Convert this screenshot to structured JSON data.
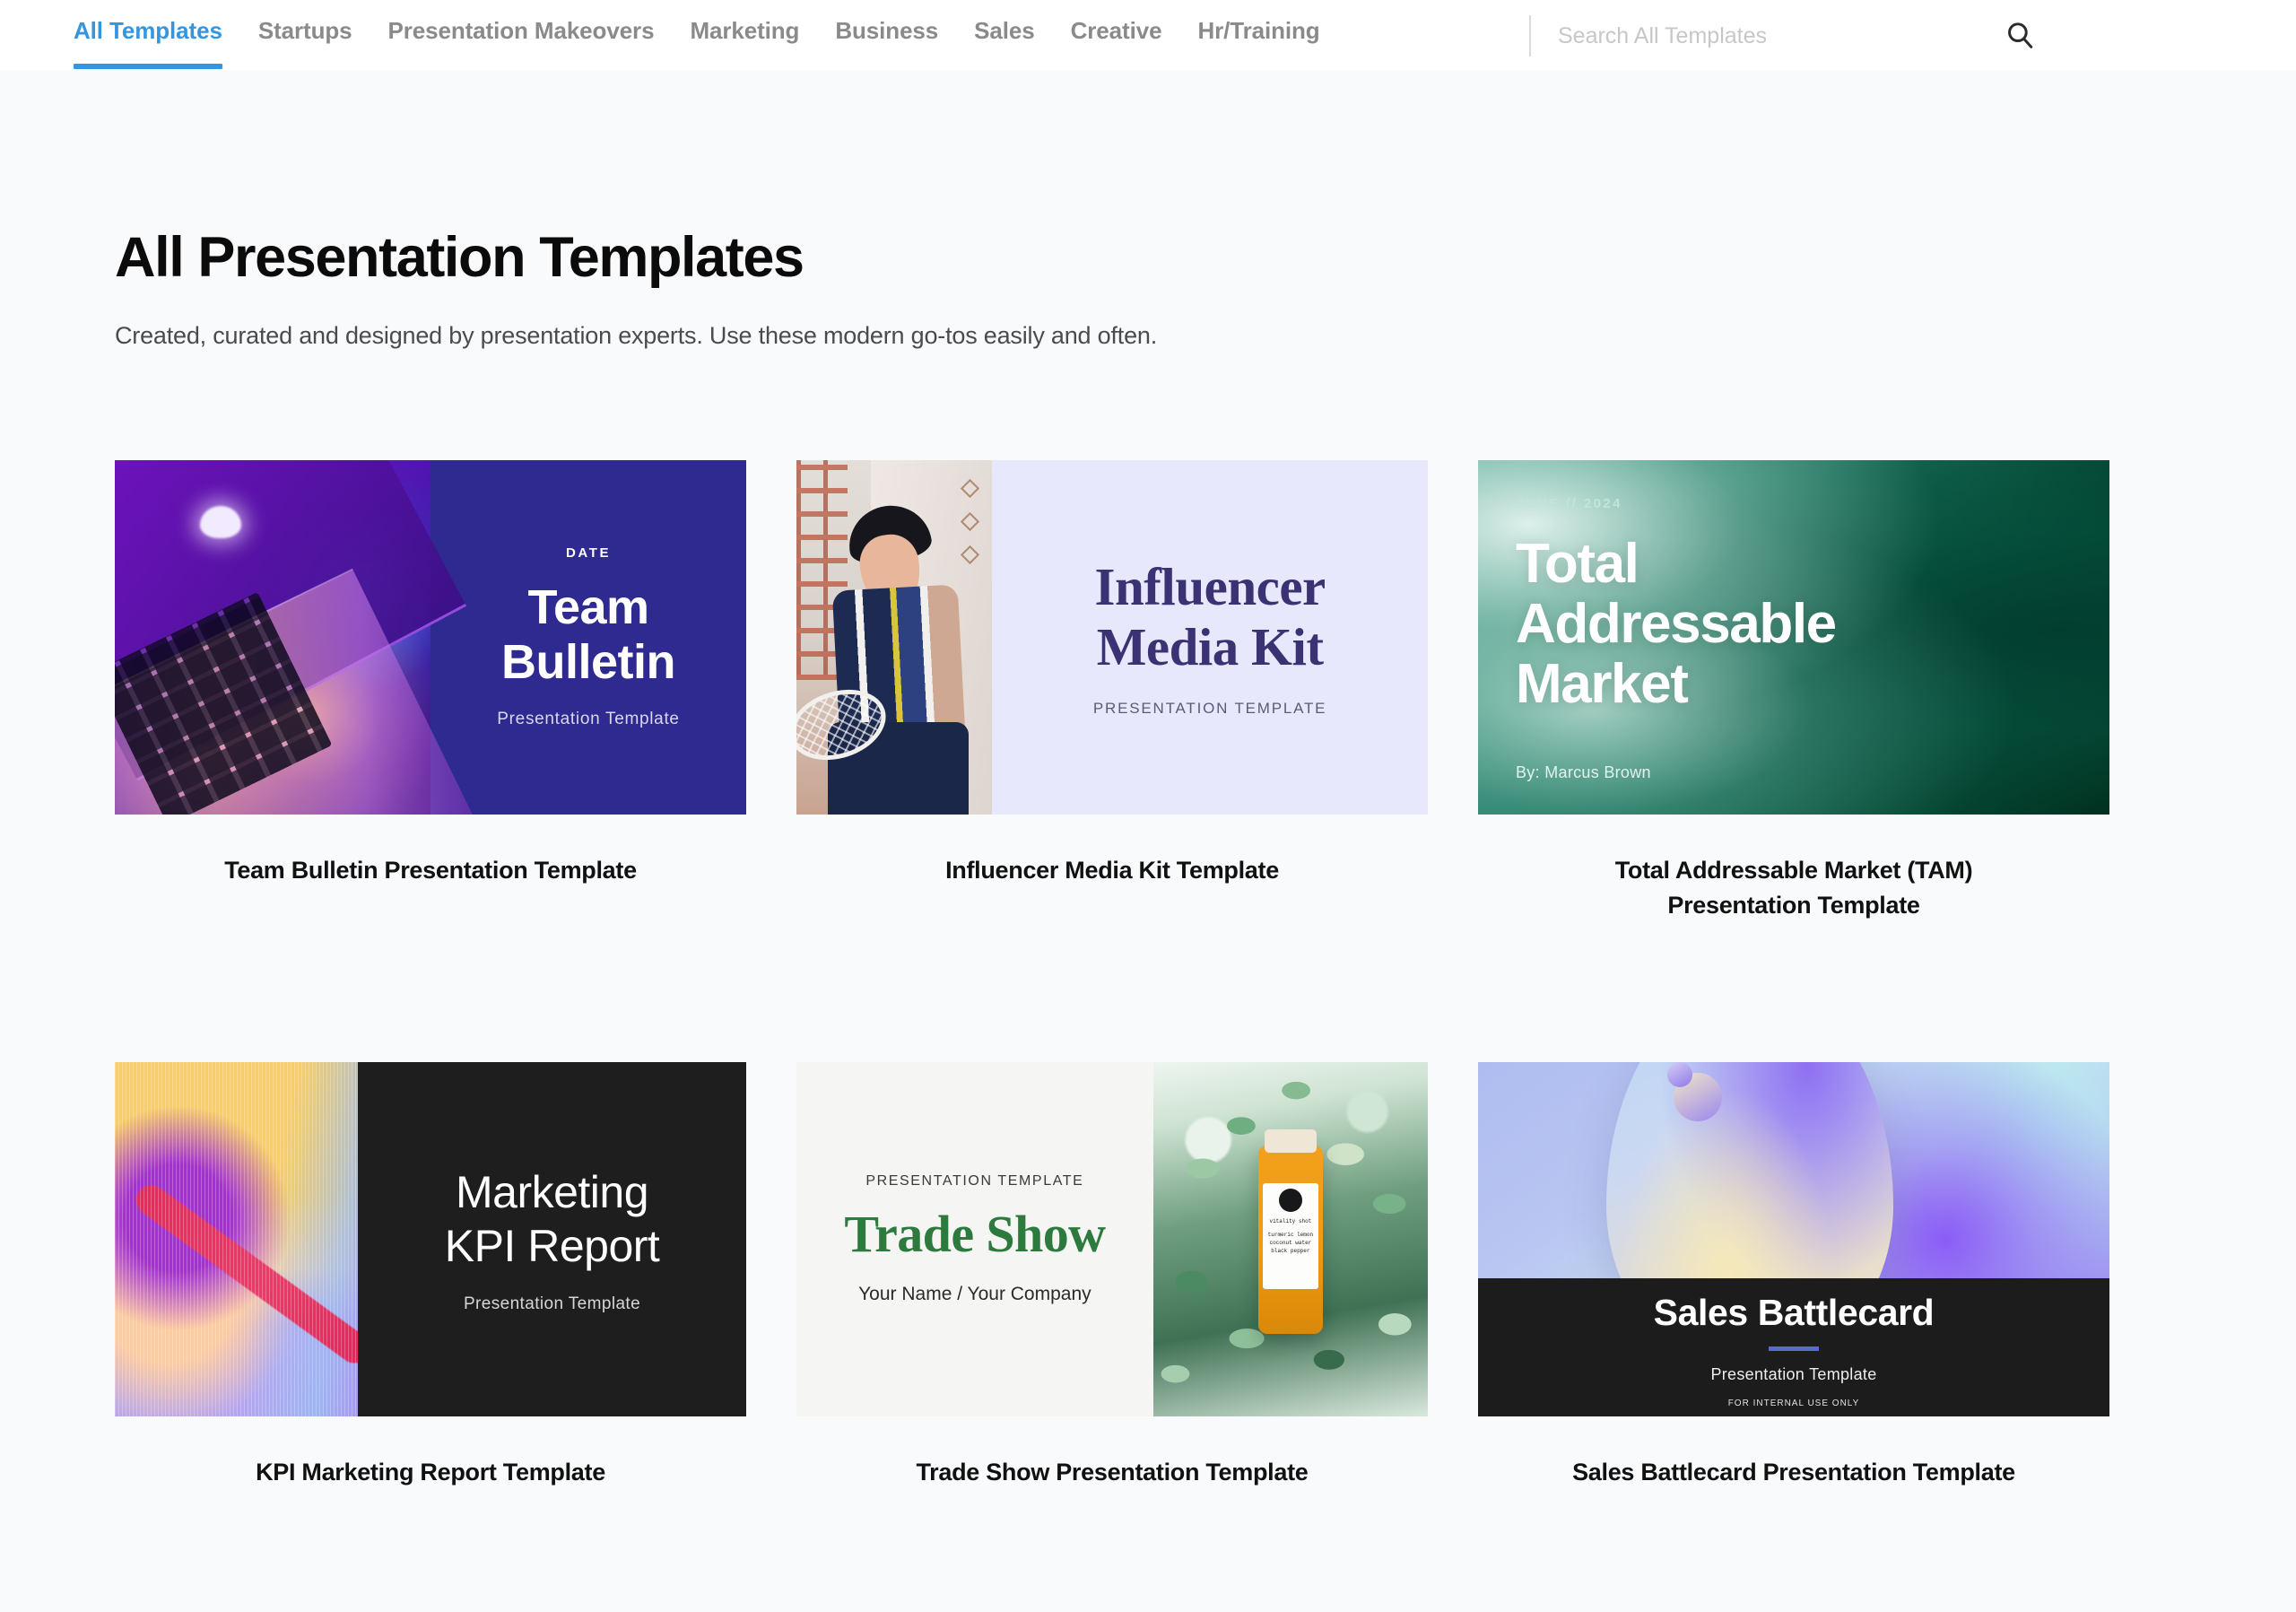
{
  "nav": {
    "tabs": [
      {
        "label": "All Templates",
        "active": true
      },
      {
        "label": "Startups",
        "active": false
      },
      {
        "label": "Presentation Makeovers",
        "active": false
      },
      {
        "label": "Marketing",
        "active": false
      },
      {
        "label": "Business",
        "active": false
      },
      {
        "label": "Sales",
        "active": false
      },
      {
        "label": "Creative",
        "active": false
      },
      {
        "label": "Hr/Training",
        "active": false
      }
    ],
    "search": {
      "placeholder": "Search All Templates",
      "value": "",
      "icon": "search-icon"
    },
    "active_color": "#3396e0"
  },
  "header": {
    "title": "All Presentation Templates",
    "subtitle": "Created, curated and designed by presentation experts. Use these modern go-tos easily and often."
  },
  "cards": [
    {
      "label": "Team Bulletin Presentation Template",
      "slide": {
        "date": "DATE",
        "title_line1": "Team",
        "title_line2": "Bulletin",
        "subtitle": "Presentation Template"
      }
    },
    {
      "label": "Influencer Media Kit Template",
      "slide": {
        "title_line1": "Influencer",
        "title_line2": "Media Kit",
        "subtitle": "PRESENTATION TEMPLATE"
      }
    },
    {
      "label": "Total Addressable Market (TAM) Presentation Template",
      "label_line1": "Total Addressable Market (TAM)",
      "label_line2": "Presentation Template",
      "slide": {
        "date": "JUNE // 2024",
        "title_line1": "Total",
        "title_line2": "Addressable",
        "title_line3": "Market",
        "byline": "By: Marcus Brown"
      }
    },
    {
      "label": "KPI Marketing Report Template",
      "slide": {
        "title_line1": "Marketing",
        "title_line2": "KPI Report",
        "subtitle": "Presentation Template"
      }
    },
    {
      "label": "Trade Show Presentation Template",
      "slide": {
        "eyebrow": "PRESENTATION TEMPLATE",
        "title": "Trade Show",
        "byline": "Your Name / Your Company",
        "bottle": {
          "product": "vitality shot",
          "ingredients": "turmeric\nlemon\ncoconut water\nblack pepper"
        }
      }
    },
    {
      "label": "Sales Battlecard Presentation Template",
      "slide": {
        "title": "Sales Battlecard",
        "subtitle": "Presentation Template",
        "note": "FOR INTERNAL USE ONLY",
        "accent_color": "#5b6ad0"
      }
    }
  ]
}
